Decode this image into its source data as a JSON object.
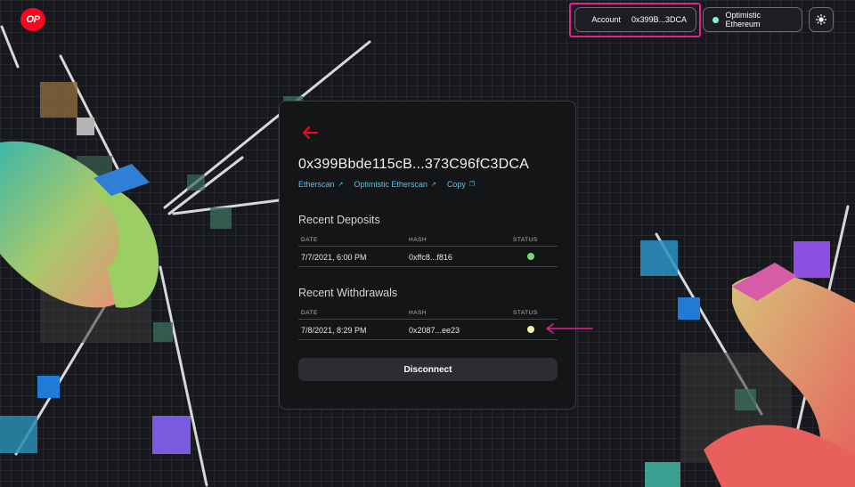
{
  "header": {
    "logo_text": "OP",
    "account_label": "Account",
    "account_address": "0x399B...3DCA",
    "network_name": "Optimistic Ethereum",
    "highlight_color": "#e4218f",
    "network_status_color": "#7ef2d3"
  },
  "card": {
    "address": "0x399Bbde115cB...373C96fC3DCA",
    "links": [
      {
        "label": "Etherscan",
        "icon": "external-link-icon"
      },
      {
        "label": "Optimistic Etherscan",
        "icon": "external-link-icon"
      },
      {
        "label": "Copy",
        "icon": "copy-icon"
      }
    ],
    "deposits": {
      "title": "Recent Deposits",
      "columns": [
        "DATE",
        "HASH",
        "STATUS"
      ],
      "rows": [
        {
          "date": "7/7/2021, 6:00 PM",
          "hash": "0xffc8...f816",
          "status_color": "#7bd67a"
        }
      ]
    },
    "withdrawals": {
      "title": "Recent Withdrawals",
      "columns": [
        "DATE",
        "HASH",
        "STATUS"
      ],
      "rows": [
        {
          "date": "7/8/2021, 8:29 PM",
          "hash": "0x2087...ee23",
          "status_color": "#f4f3a6"
        }
      ]
    },
    "disconnect_label": "Disconnect",
    "accent_color": "#ff0420"
  }
}
